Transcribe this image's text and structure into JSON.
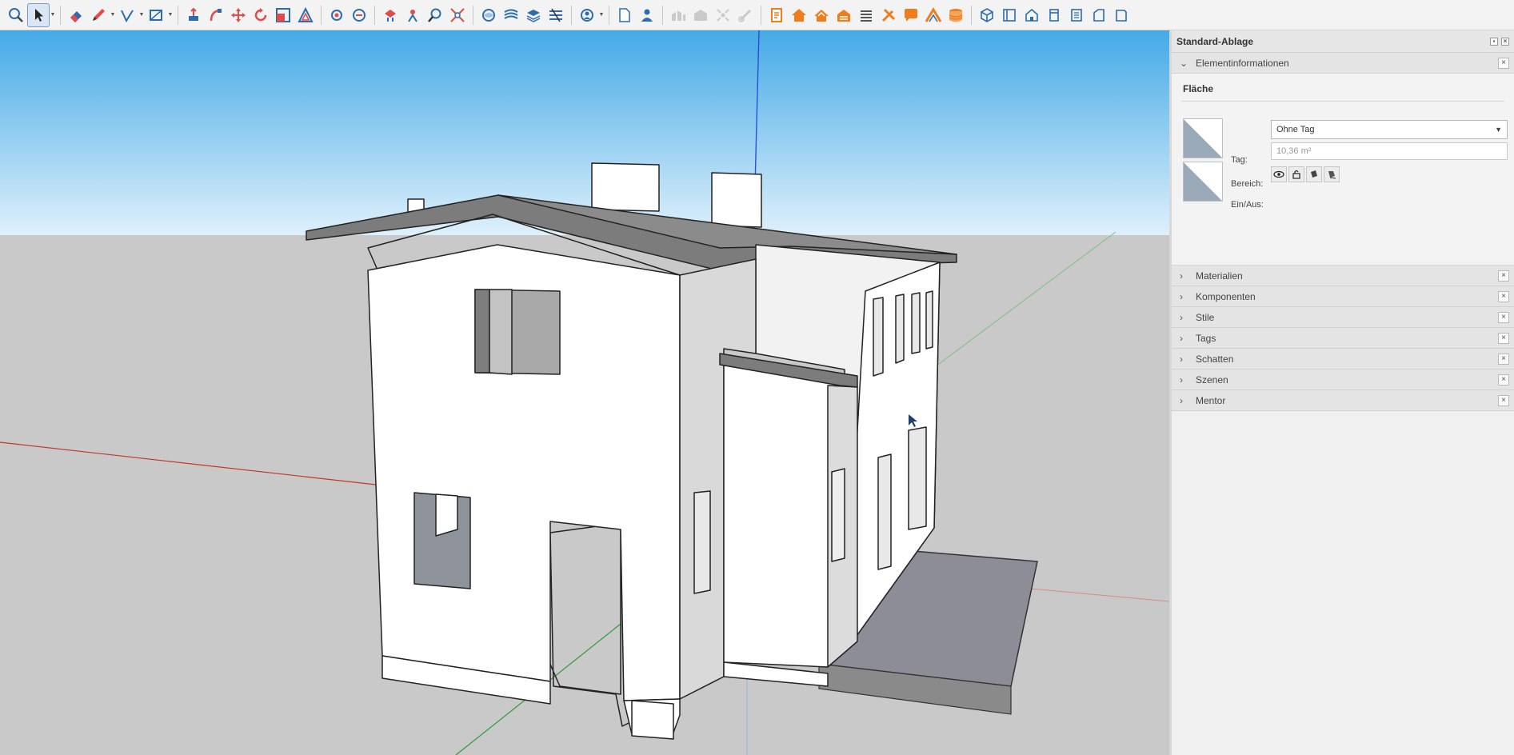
{
  "toolbar": {
    "groups": [
      [
        "search-tool",
        "select-tool",
        "select-dropdown"
      ],
      [
        "eraser-tool",
        "pencil-tool",
        "line-tool",
        "rectangle-tool"
      ],
      [
        "push-pull-tool",
        "follow-me-tool",
        "move-tool",
        "rotate-tool",
        "scale-tool",
        "offset-tool"
      ],
      [
        "orbit-tool",
        "pan-tool",
        "walk-tool",
        "look-around-tool",
        "zoom-tool",
        "zoom-extents-tool"
      ],
      [
        "sandbox-tool",
        "smoove-tool",
        "stamp-tool",
        "drape-tool"
      ],
      [
        "warehouse-tool"
      ],
      [
        "new-document",
        "person-icon"
      ],
      [
        "disabled-tool-1",
        "disabled-tool-2",
        "disabled-tool-3",
        "disabled-tool-4"
      ],
      [
        "report-tool",
        "house-tool",
        "house-tool-2",
        "house-tool-3",
        "list-tool",
        "tools-tool",
        "chat-tool",
        "roof-tool",
        "layers-tool"
      ],
      [
        "view-iso",
        "view-top",
        "view-front",
        "view-right",
        "view-back",
        "view-left",
        "view-bottom"
      ]
    ]
  },
  "tray": {
    "title": "Standard-Ablage",
    "entity_info": {
      "header": "Elementinformationen",
      "type_label": "Fläche",
      "tag_label": "Tag:",
      "tag_value": "Ohne Tag",
      "area_label": "Bereich:",
      "area_value": "10,36 m²",
      "toggle_label": "Ein/Aus:"
    },
    "panels": [
      "Materialien",
      "Komponenten",
      "Stile",
      "Tags",
      "Schatten",
      "Szenen",
      "Mentor"
    ]
  },
  "colors": {
    "sky_top": "#4fb0e8",
    "sky_bottom": "#d9eefb",
    "ground": "#c9c9c9",
    "wall_light": "#ffffff",
    "wall_shade": "#dedede",
    "roof": "#7c7c7c",
    "axis_red": "#c0392b",
    "axis_green": "#2e9a3a",
    "axis_blue": "#2b4fd8",
    "accent_orange": "#f07d1b"
  }
}
